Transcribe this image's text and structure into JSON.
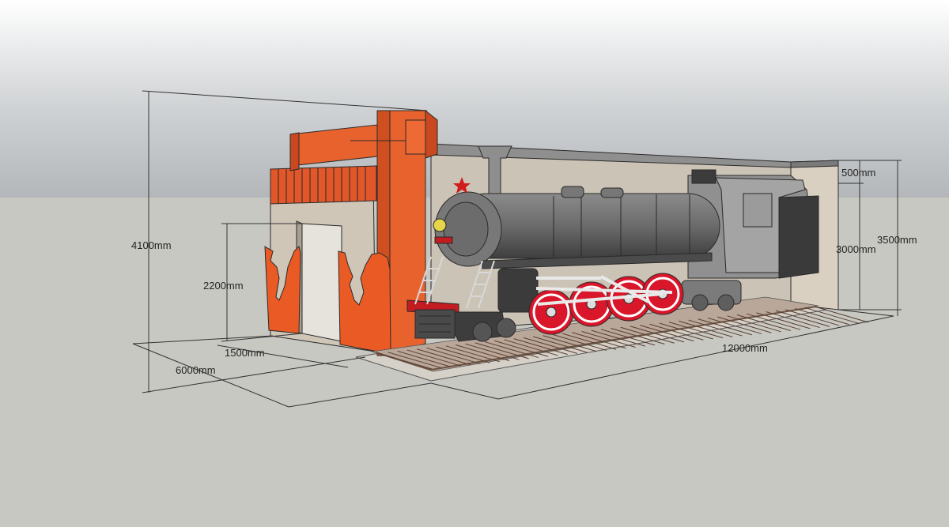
{
  "dimensions": {
    "total_height": "4100mm",
    "door_height": "2200mm",
    "door_width": "1500mm",
    "depth": "6000mm",
    "length": "12000mm",
    "top_band": "500mm",
    "inner_height": "3000mm",
    "back_height": "3500mm"
  },
  "colors": {
    "sky": "#b9bcbf",
    "ground": "#c9c9c4",
    "facade_orange": "#e8622e",
    "wall": "#cfc6b8",
    "locomotive_body": "#6f706f",
    "wheels": "#d9162a",
    "rails": "#9a6e5a"
  }
}
